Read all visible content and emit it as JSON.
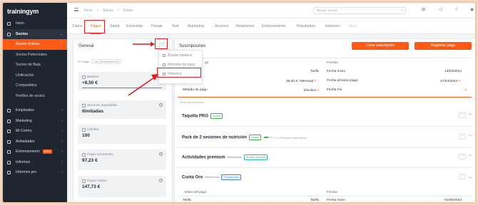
{
  "app": {
    "logo": "trainingym"
  },
  "sidebar": {
    "items": [
      {
        "label": "Inicio",
        "icon": "home-icon",
        "chevron": ""
      },
      {
        "label": "Socios",
        "icon": "users-icon",
        "chevron": "⌄"
      },
      {
        "label": "Socios Activos",
        "sub": true,
        "active": true
      },
      {
        "label": "Socios Potenciales",
        "sub": true
      },
      {
        "label": "Socios de Baja",
        "sub": true
      },
      {
        "label": "Unificación",
        "sub": true
      },
      {
        "label": "Compartidos",
        "sub": true
      },
      {
        "label": "Perfiles de socios",
        "sub": true
      },
      {
        "label": "Empleados",
        "icon": "employee-icon",
        "chevron": "›"
      },
      {
        "label": "Marketing",
        "icon": "megaphone-icon",
        "chevron": "›"
      },
      {
        "label": "Mi Centro",
        "icon": "building-icon",
        "chevron": "›"
      },
      {
        "label": "Actividades",
        "icon": "calendar-icon",
        "chevron": "›"
      },
      {
        "label": "Entrenamiento",
        "icon": "dumbbell-icon",
        "chevron": "›",
        "badge": "NEW"
      },
      {
        "label": "Informes",
        "icon": "chart-icon",
        "chevron": "›"
      },
      {
        "label": "Informes pro",
        "icon": "chart-pro-icon",
        "chevron": "›"
      }
    ]
  },
  "topbar": {
    "breadcrumbs": [
      "Inicio",
      "/",
      "Socios",
      "/",
      "Datos"
    ],
    "search_placeholder": "Buscar Socios"
  },
  "tabs": [
    "Datos",
    "Pagos",
    "Salud",
    "Entrevista",
    "Pesaje",
    "Test",
    "Marketing",
    "Accesos",
    "Relaciones",
    "Entrenamiento",
    "Resultados",
    "Histórico",
    "Otros"
  ],
  "active_tab": "Pagos",
  "general": {
    "title": "General",
    "dots": "···",
    "id_label": "ID Single",
    "id_value": "Lsa_f3f9d4dcfbe1c3",
    "stats": [
      {
        "label": "Balance",
        "value": "+8,50 €",
        "bar": 1.0
      },
      {
        "label": "Sesiones disponibles",
        "value": "Ilimitadas",
        "info": "i"
      },
      {
        "label": "Créditos",
        "value": "100"
      },
      {
        "label": "Pagos recurrentes",
        "value": "97,23 €",
        "info": "i"
      },
      {
        "label": "Pagos totales",
        "value": "147,73 €",
        "info": "i"
      }
    ]
  },
  "dropdown": {
    "items": [
      "Ajustar balance",
      "Métodos de pago",
      "Historico"
    ]
  },
  "subscriptions": {
    "title": "Suscripciones",
    "btn_create": "Crear suscripción",
    "btn_register": "Registrar pago",
    "header_left": "go",
    "header_right": "Fechas",
    "rows": [
      {
        "label": "Tarifa",
        "date_label": "Fecha Inicio",
        "date": "13/03/2024"
      },
      {
        "label": "Precio",
        "value": "35,00 € / Mensual",
        "date_label": "Fecha próximo pago",
        "date": "17/04/2024"
      },
      {
        "label": "Método de pago",
        "value": "Efectivo",
        "date_label": "Fecha Fin",
        "date": ""
      }
    ],
    "others_label": "Otras suscripciones",
    "items": [
      {
        "name": "Taquilla PRO",
        "tags": [
          {
            "text": "Activa",
            "color": "green"
          }
        ]
      },
      {
        "name": "Pack de 2 sesiones de nutrición",
        "tags": [
          {
            "text": "Activa",
            "color": "green"
          }
        ],
        "progress": 0.5,
        "progress_text": "2 / 2 Sesiones disponibles"
      },
      {
        "name": "Actividades premium",
        "tags": [
          {
            "text": "Membresía",
            "color": "plain"
          },
          {
            "text": "Prueba gratuita",
            "color": "teal"
          }
        ]
      },
      {
        "name": "Cuota Oro",
        "tags": [
          {
            "text": "Membresía",
            "color": "plain"
          },
          {
            "text": "Programado",
            "color": "blue"
          }
        ]
      }
    ],
    "bottom": {
      "left_header": "Datos del pago",
      "right_header": "Fechas",
      "left_row": "Tarifa",
      "right_row": "Fecha Inicio",
      "right_date": "01/05/2024"
    }
  },
  "colors": {
    "accent": "#ff5a14",
    "sidebar": "#1f2632",
    "highlight": "#e21b1b"
  }
}
